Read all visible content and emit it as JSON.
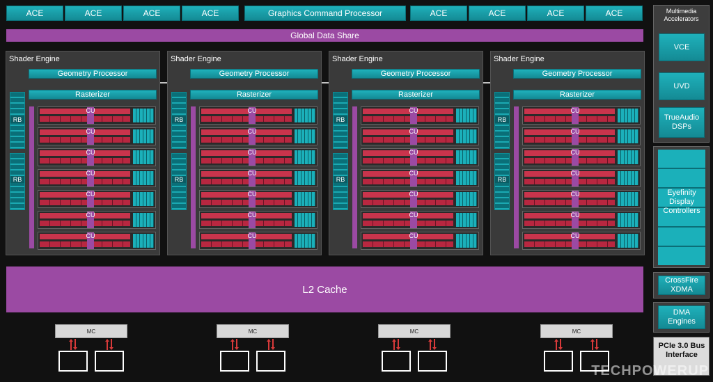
{
  "top_row": {
    "ace_left": [
      "ACE",
      "ACE",
      "ACE",
      "ACE"
    ],
    "gcp": "Graphics Command Processor",
    "ace_right": [
      "ACE",
      "ACE",
      "ACE",
      "ACE"
    ]
  },
  "global_data_share": "Global Data Share",
  "shader_engines": [
    {
      "title": "Shader Engine",
      "geometry": "Geometry Processor",
      "rasterizer": "Rasterizer",
      "rb_labels": [
        "RB",
        "RB"
      ],
      "cu_labels": [
        "CU",
        "CU",
        "CU",
        "CU",
        "CU",
        "CU",
        "CU"
      ]
    },
    {
      "title": "Shader Engine",
      "geometry": "Geometry Processor",
      "rasterizer": "Rasterizer",
      "rb_labels": [
        "RB",
        "RB"
      ],
      "cu_labels": [
        "CU",
        "CU",
        "CU",
        "CU",
        "CU",
        "CU",
        "CU"
      ]
    },
    {
      "title": "Shader Engine",
      "geometry": "Geometry Processor",
      "rasterizer": "Rasterizer",
      "rb_labels": [
        "RB",
        "RB"
      ],
      "cu_labels": [
        "CU",
        "CU",
        "CU",
        "CU",
        "CU",
        "CU",
        "CU"
      ]
    },
    {
      "title": "Shader Engine",
      "geometry": "Geometry Processor",
      "rasterizer": "Rasterizer",
      "rb_labels": [
        "RB",
        "RB"
      ],
      "cu_labels": [
        "CU",
        "CU",
        "CU",
        "CU",
        "CU",
        "CU",
        "CU"
      ]
    }
  ],
  "l2_cache": "L2 Cache",
  "multimedia": {
    "title": "Multimedia Accelerators",
    "items": [
      "VCE",
      "UVD",
      "TrueAudio DSPs"
    ]
  },
  "eyefinity": "Eyefinity Display Controllers",
  "crossfire": "CrossFire XDMA",
  "dma": "DMA Engines",
  "pcie": "PCIe 3.0 Bus Interface",
  "memory_controllers": [
    "MC",
    "MC",
    "MC",
    "MC"
  ],
  "watermark": "TECHPOWERUP",
  "colors": {
    "teal": "#1fb1bb",
    "purple": "#9b4aa3",
    "red": "#c9344c",
    "background": "#111111"
  }
}
